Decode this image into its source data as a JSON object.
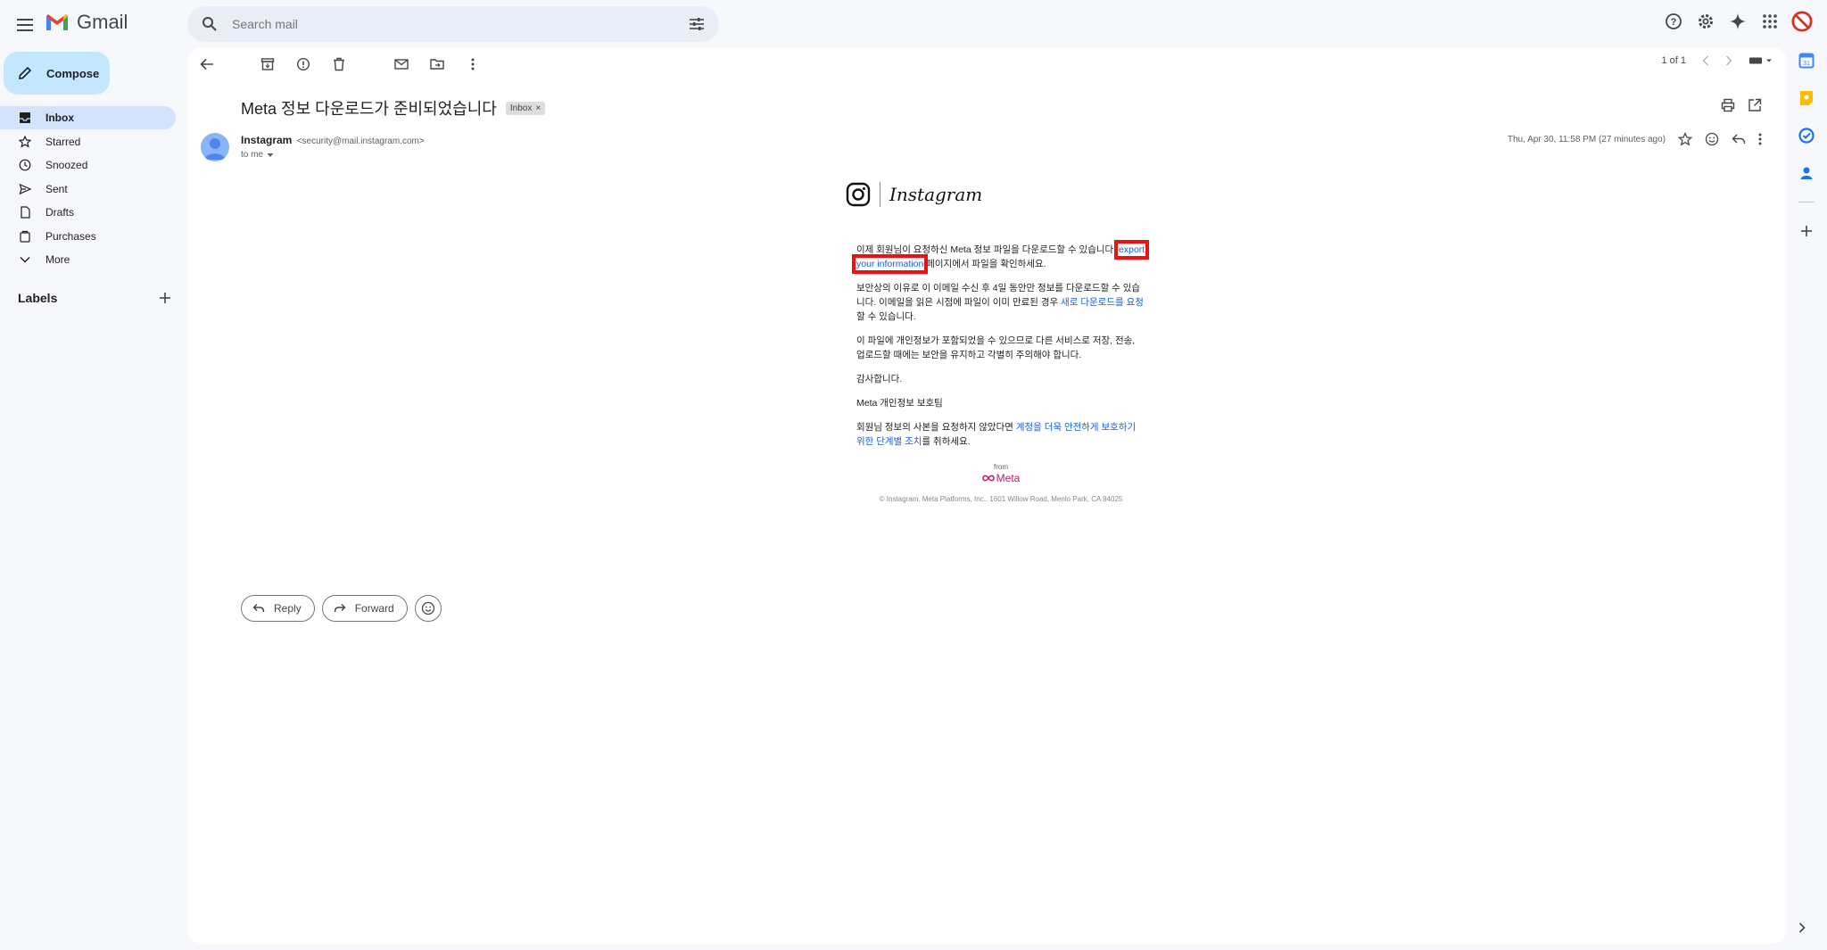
{
  "app": {
    "name": "Gmail"
  },
  "search": {
    "placeholder": "Search mail"
  },
  "compose": {
    "label": "Compose"
  },
  "nav": {
    "items": [
      {
        "label": "Inbox",
        "icon": "inbox-icon",
        "active": true
      },
      {
        "label": "Starred",
        "icon": "star-icon"
      },
      {
        "label": "Snoozed",
        "icon": "clock-icon"
      },
      {
        "label": "Sent",
        "icon": "send-icon"
      },
      {
        "label": "Drafts",
        "icon": "draft-icon"
      },
      {
        "label": "Purchases",
        "icon": "purchases-icon"
      },
      {
        "label": "More",
        "icon": "chevron-down-icon"
      }
    ],
    "labels_title": "Labels"
  },
  "pager": {
    "text": "1 of 1"
  },
  "message": {
    "subject": "Meta 정보 다운로드가 준비되었습니다",
    "badge": "Inbox",
    "sender_name": "Instagram",
    "sender_email": "<security@mail.instagram.com>",
    "to": "to me",
    "date": "Thu, Apr 30, 11:58 PM (27 minutes ago)"
  },
  "email": {
    "brand": "Instagram",
    "p1_before": "이제 회원님이 요청하신 Meta 정보 파일을 다운로드할 수 있습니다. ",
    "p1_link_a": "export",
    "p1_link_b": "your information",
    "p1_after": " 페이지에서 파일을 확인하세요.",
    "p2_before": "보안상의 이유로 이 이메일 수신 후 4일 동안만 정보를 다운로드할 수 있습니다. 이메일을 읽은 시점에 파일이 이미 만료된 경우 ",
    "p2_link": "새로 다운로드를 요청",
    "p2_after": "할 수 있습니다.",
    "p3": "이 파일에 개인정보가 포함되었을 수 있으므로 다른 서비스로 저장, 전송, 업로드할 때에는 보안을 유지하고 각별히 주의해야 합니다.",
    "p4": "감사합니다.",
    "p5": "Meta 개인정보 보호팀",
    "p6_before": "회원님 정보의 사본을 요청하지 않았다면 ",
    "p6_link": "계정을 더욱 안전하게 보호하기 위한 단계별 조치",
    "p6_after": "를 취하세요.",
    "from_label": "from",
    "meta_brand": "Meta",
    "copyright": "© Instagram. Meta Platforms, Inc., 1601 Willow Road, Menlo Park, CA 94025"
  },
  "actions": {
    "reply": "Reply",
    "forward": "Forward"
  },
  "colors": {
    "accent_link": "#1a5ee0",
    "highlight": "#ee1111",
    "compose_bg": "#c2e7ff",
    "active_nav": "#d3e3fd"
  }
}
